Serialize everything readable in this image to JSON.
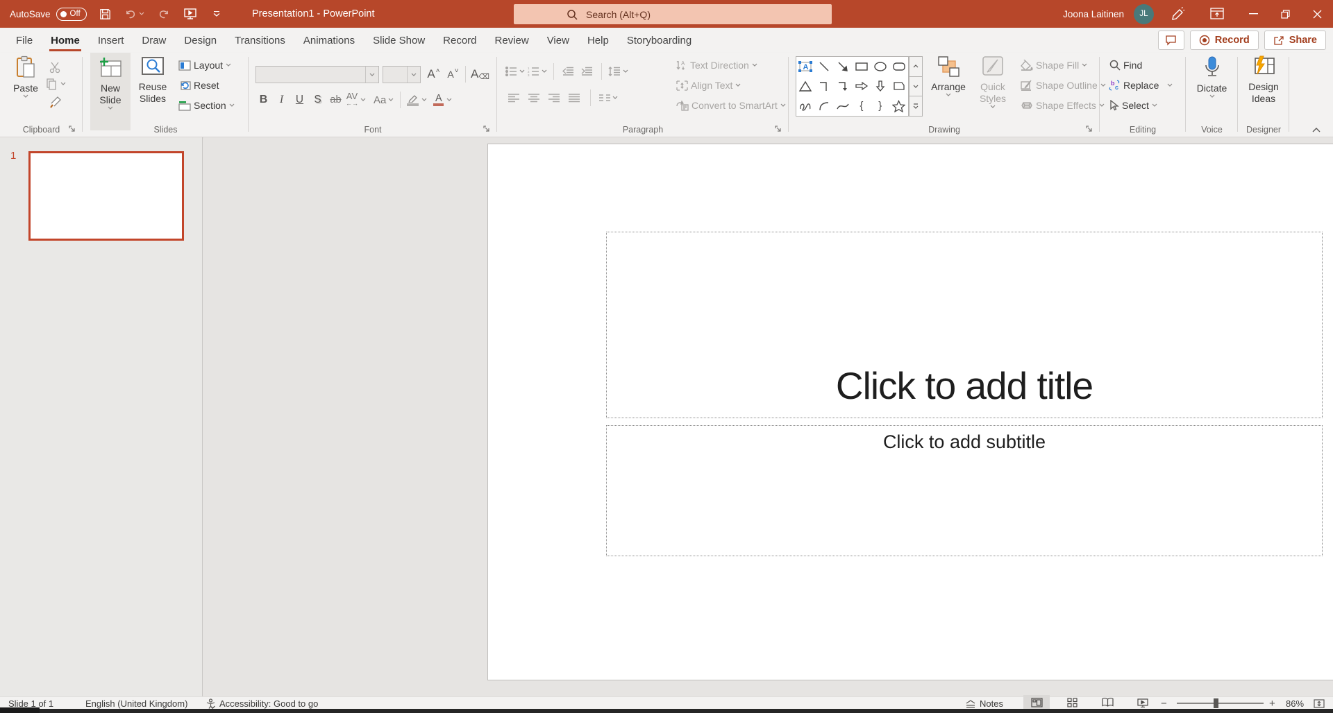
{
  "titlebar": {
    "autosave_label": "AutoSave",
    "autosave_state": "Off",
    "title": "Presentation1 - PowerPoint",
    "search_placeholder": "Search (Alt+Q)",
    "user_name": "Joona Laitinen",
    "user_initials": "JL"
  },
  "tabs": [
    "File",
    "Home",
    "Insert",
    "Draw",
    "Design",
    "Transitions",
    "Animations",
    "Slide Show",
    "Record",
    "Review",
    "View",
    "Help",
    "Storyboarding"
  ],
  "active_tab": "Home",
  "top_actions": {
    "record": "Record",
    "share": "Share"
  },
  "ribbon": {
    "clipboard": {
      "label": "Clipboard",
      "paste": "Paste"
    },
    "slides": {
      "label": "Slides",
      "new_slide": "New Slide",
      "reuse_slides": "Reuse Slides",
      "layout": "Layout",
      "reset": "Reset",
      "section": "Section"
    },
    "font": {
      "label": "Font"
    },
    "paragraph": {
      "label": "Paragraph",
      "text_direction": "Text Direction",
      "align_text": "Align Text",
      "convert_smartart": "Convert to SmartArt"
    },
    "drawing": {
      "label": "Drawing",
      "arrange": "Arrange",
      "quick_styles": "Quick Styles",
      "shape_fill": "Shape Fill",
      "shape_outline": "Shape Outline",
      "shape_effects": "Shape Effects"
    },
    "editing": {
      "label": "Editing",
      "find": "Find",
      "replace": "Replace",
      "select": "Select"
    },
    "voice": {
      "label": "Voice",
      "dictate": "Dictate"
    },
    "designer": {
      "label": "Designer",
      "design_ideas": "Design Ideas"
    }
  },
  "icons": {
    "bold": "B",
    "italic": "I",
    "underline": "U",
    "shadow": "S",
    "strikethrough": "ab",
    "char_spacing": "AV",
    "change_case": "Aa",
    "grow_font": "A",
    "shrink_font": "A",
    "clear_formatting": "A",
    "font_color": "A",
    "brace_open": "{",
    "brace_close": "}"
  },
  "slide_panel": {
    "slide_number": "1"
  },
  "slide": {
    "title_placeholder": "Click to add title",
    "subtitle_placeholder": "Click to add subtitle"
  },
  "statusbar": {
    "slide_info": "Slide 1 of 1",
    "language": "English (United Kingdom)",
    "accessibility": "Accessibility: Good to go",
    "notes": "Notes",
    "zoom_level": "86%"
  },
  "colors": {
    "accent": "#B7472A",
    "search_bg": "#F3C5B1",
    "ribbon_bg": "#F3F2F1",
    "canvas_bg": "#E6E4E2",
    "thumb_border": "#C2452A",
    "avatar_bg": "#49797A",
    "mic_blue": "#3B8BD9",
    "bolt_orange": "#F7A800"
  }
}
